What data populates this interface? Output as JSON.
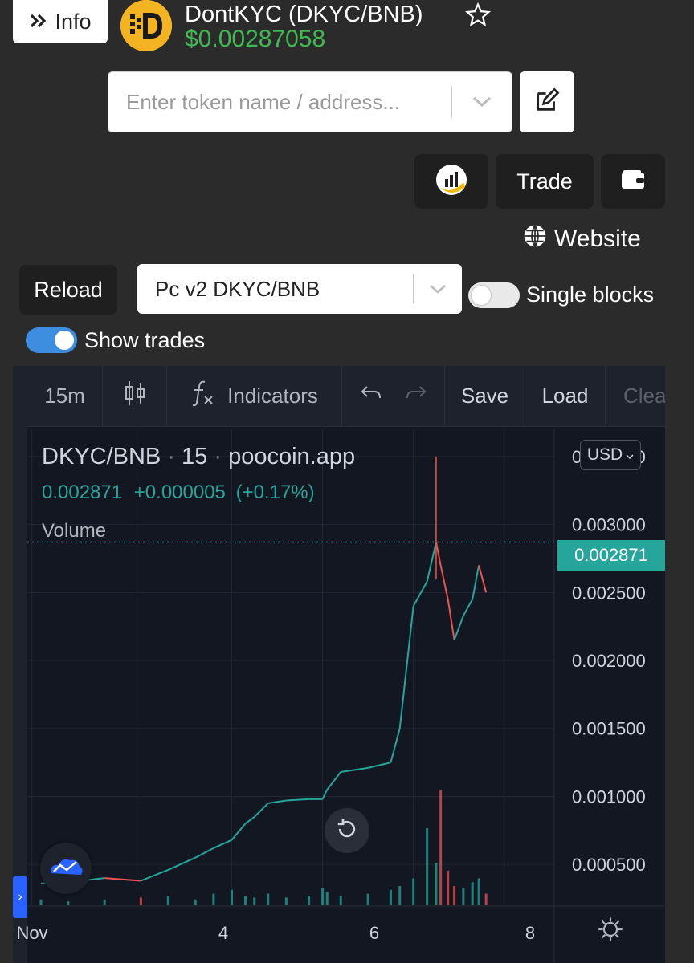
{
  "header": {
    "info_label": "Info",
    "token_title": "DontKYC (DKYC/BNB)",
    "token_price": "$0.00287058",
    "logo_letter": "D"
  },
  "search": {
    "placeholder": "Enter token name / address..."
  },
  "actions": {
    "trade_label": "Trade",
    "website_label": "Website"
  },
  "controls": {
    "reload_label": "Reload",
    "pair_selected": "Pc v2 DKYC/BNB",
    "single_blocks_label": "Single blocks",
    "single_blocks_on": false,
    "show_trades_label": "Show trades",
    "show_trades_on": true
  },
  "toolbar": {
    "interval": "15m",
    "indicators_label": "Indicators",
    "save_label": "Save",
    "load_label": "Load",
    "clear_label": "Clea"
  },
  "legend": {
    "symbol": "DKYC/BNB",
    "interval": "15",
    "source": "poocoin.app",
    "last": "0.002871",
    "change": "+0.000005",
    "change_pct": "(+0.17%)",
    "volume_label": "Volume",
    "currency": "USD"
  },
  "colors": {
    "up": "#26a69a",
    "down": "#ef5350",
    "accent": "#2962ff",
    "price_green": "#3fb950"
  },
  "chart_data": {
    "type": "line",
    "title": "DKYC/BNB · 15 · poocoin.app",
    "current_price": "0.002871",
    "x_tick_labels": [
      "Nov",
      "4",
      "6",
      "8"
    ],
    "y_tick_labels": [
      "0.003500",
      "0.003000",
      "0.002500",
      "0.002000",
      "0.001500",
      "0.001000",
      "0.000500"
    ],
    "ylim": [
      0.0002,
      0.0037
    ],
    "x": [
      2.9,
      3.2,
      3.6,
      4.0,
      4.3,
      4.6,
      4.8,
      5.0,
      5.15,
      5.25,
      5.4,
      5.6,
      5.85,
      6.0,
      6.05,
      6.2,
      6.5,
      6.75,
      6.85,
      7.0,
      7.15,
      7.25,
      7.3,
      7.38,
      7.45,
      7.55,
      7.65,
      7.72,
      7.8
    ],
    "y": [
      0.00036,
      0.00037,
      0.0004,
      0.00038,
      0.00046,
      0.00055,
      0.00062,
      0.00068,
      0.0008,
      0.00085,
      0.00095,
      0.00097,
      0.00098,
      0.00098,
      0.00105,
      0.00118,
      0.00121,
      0.00125,
      0.0015,
      0.0024,
      0.00258,
      0.00287,
      0.0027,
      0.00245,
      0.00215,
      0.00233,
      0.00245,
      0.0027,
      0.0025
    ],
    "volume": [
      3,
      2,
      3,
      4,
      5,
      3,
      6,
      8,
      5,
      4,
      6,
      4,
      5,
      9,
      7,
      5,
      6,
      8,
      10,
      14,
      40,
      22,
      60,
      18,
      10,
      9,
      12,
      14,
      6
    ],
    "grid": true
  }
}
